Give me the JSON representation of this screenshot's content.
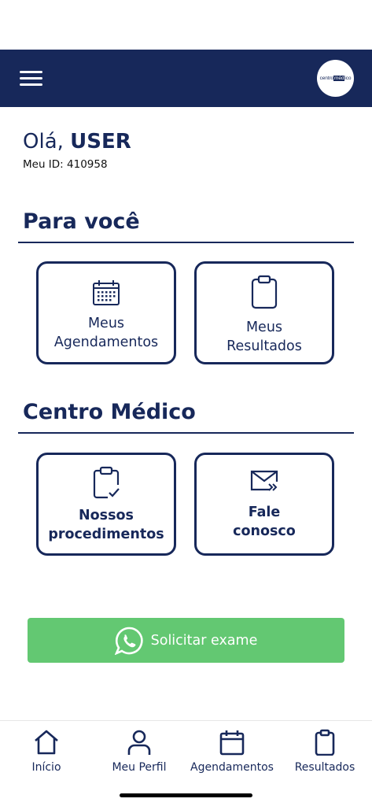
{
  "header": {
    "logo": {
      "text_before": "centro",
      "text_highlight": "méd",
      "text_after": "ico"
    }
  },
  "greeting": {
    "prefix": "Olá,",
    "user": "USER",
    "id_line": "Meu ID: 410958"
  },
  "sections": {
    "para_voce": {
      "title": "Para você",
      "cards": [
        {
          "line1": "Meus",
          "line2": "Agendamentos",
          "icon": "calendar-icon"
        },
        {
          "line1": "Meus",
          "line2": "Resultados",
          "icon": "clipboard-icon"
        }
      ]
    },
    "centro_medico": {
      "title": "Centro Médico",
      "cards": [
        {
          "line1": "Nossos",
          "line2": "procedimentos",
          "icon": "clipboard-check-icon"
        },
        {
          "line1": "Fale",
          "line2": "conosco",
          "icon": "mail-icon"
        }
      ]
    }
  },
  "whatsapp_button": {
    "label": "Solicitar exame",
    "icon": "whatsapp-icon",
    "color": "#63c872"
  },
  "tabbar": {
    "tabs": [
      {
        "label": "Início",
        "icon": "home-icon"
      },
      {
        "label": "Meu Perfil",
        "icon": "user-icon"
      },
      {
        "label": "Agendamentos",
        "icon": "calendar-icon"
      },
      {
        "label": "Resultados",
        "icon": "clipboard-icon"
      }
    ]
  },
  "colors": {
    "primary": "#17285a",
    "accent": "#63c872",
    "background": "#ffffff"
  }
}
